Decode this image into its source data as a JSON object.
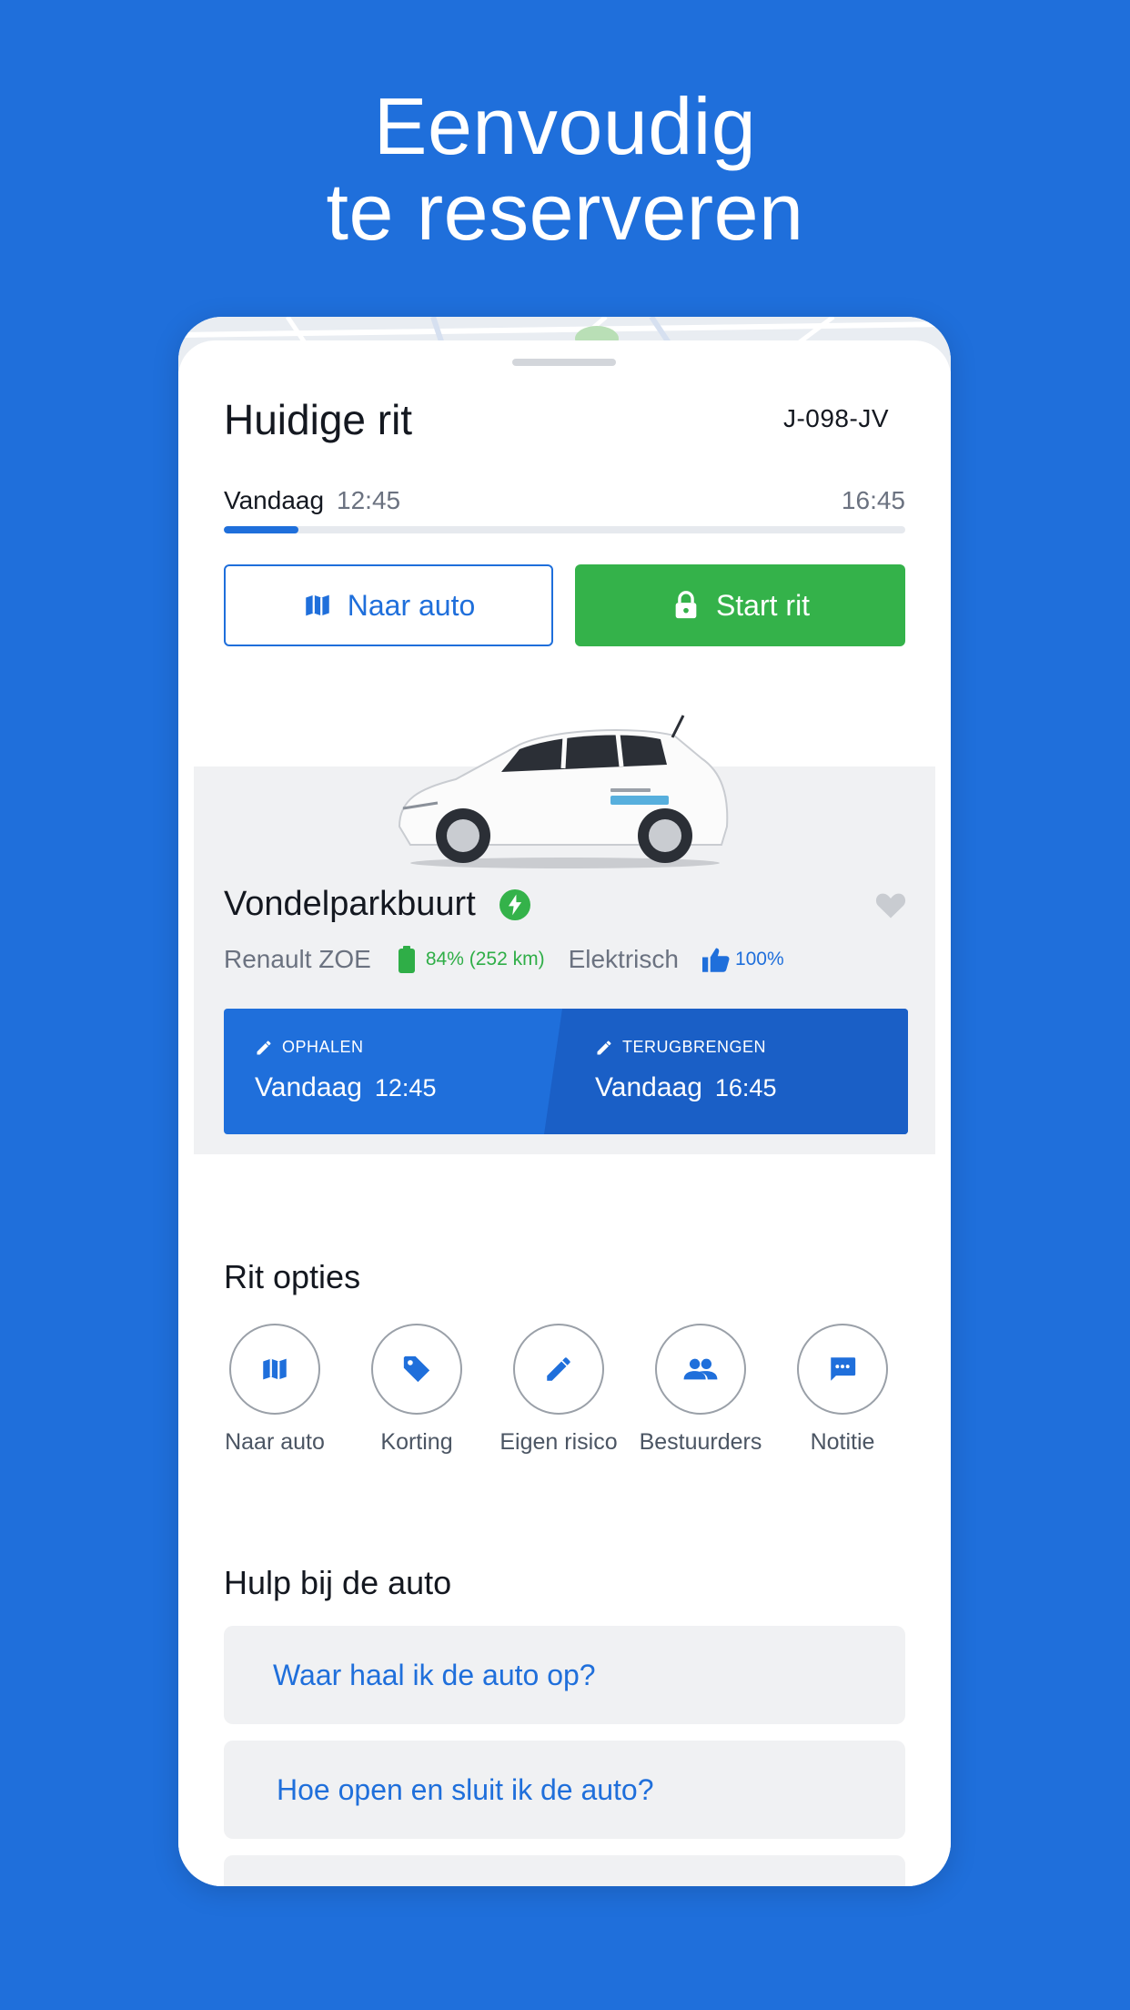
{
  "headline": {
    "line1": "Eenvoudig",
    "line2": "te reserveren"
  },
  "trip": {
    "title": "Huidige rit",
    "plate": "J-098-JV",
    "day": "Vandaag",
    "start_time": "12:45",
    "end_time": "16:45",
    "progress_fraction": 0.11
  },
  "actions": {
    "navigate_label": "Naar auto",
    "start_label": "Start rit"
  },
  "car": {
    "location": "Vondelparkbuurt",
    "model": "Renault ZOE",
    "battery": "84% (252 km)",
    "fuel": "Elektrisch",
    "rating": "100%",
    "ev_badge_icon": "lightning-icon",
    "favorite_icon": "heart-icon"
  },
  "period": {
    "pickup_caption": "OPHALEN",
    "pickup_day": "Vandaag",
    "pickup_time": "12:45",
    "return_caption": "TERUGBRENGEN",
    "return_day": "Vandaag",
    "return_time": "16:45"
  },
  "options": {
    "title": "Rit opties",
    "items": [
      {
        "label": "Naar auto",
        "icon": "map-icon"
      },
      {
        "label": "Korting",
        "icon": "tag-icon"
      },
      {
        "label": "Eigen risico",
        "icon": "pencil-icon"
      },
      {
        "label": "Bestuurders",
        "icon": "people-icon"
      },
      {
        "label": "Notitie",
        "icon": "chat-icon"
      }
    ]
  },
  "help": {
    "title": "Hulp bij de auto",
    "items": [
      "Waar haal ik de auto op?",
      "Hoe open en sluit ik de auto?"
    ]
  },
  "colors": {
    "brand_blue": "#1f6fdb",
    "start_green": "#34b24a",
    "card_grey": "#f0f1f3"
  }
}
